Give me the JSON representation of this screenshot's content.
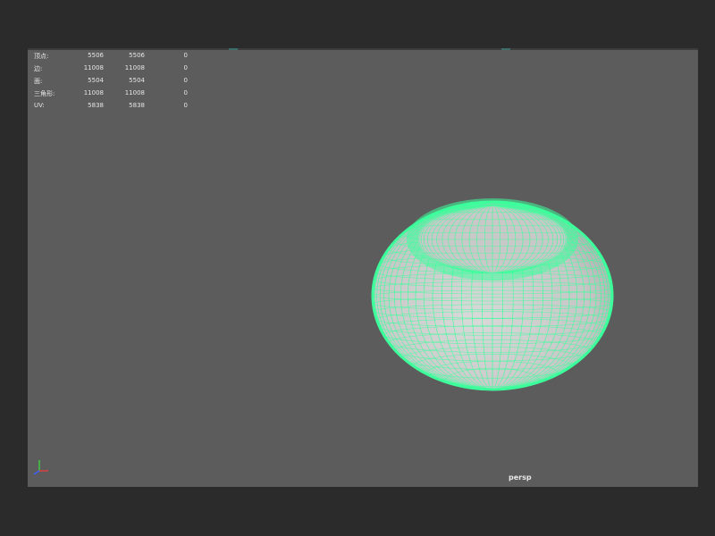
{
  "viewport": {
    "camera_name": "persp",
    "background_color": "#5c5c5c",
    "wireframe_color": "#3cff9c"
  },
  "hud": {
    "rows": [
      {
        "label": "顶点:",
        "values": [
          "5506",
          "5506",
          "0"
        ]
      },
      {
        "label": "边:",
        "values": [
          "11008",
          "11008",
          "0"
        ]
      },
      {
        "label": "面:",
        "values": [
          "5504",
          "5504",
          "0"
        ]
      },
      {
        "label": "三角形:",
        "values": [
          "11008",
          "11008",
          "0"
        ]
      },
      {
        "label": "UV:",
        "values": [
          "5838",
          "5838",
          "0"
        ]
      }
    ]
  },
  "axis_gizmo": {
    "colors": {
      "x": "#e04040",
      "y": "#40d040",
      "z": "#4060ff"
    }
  }
}
